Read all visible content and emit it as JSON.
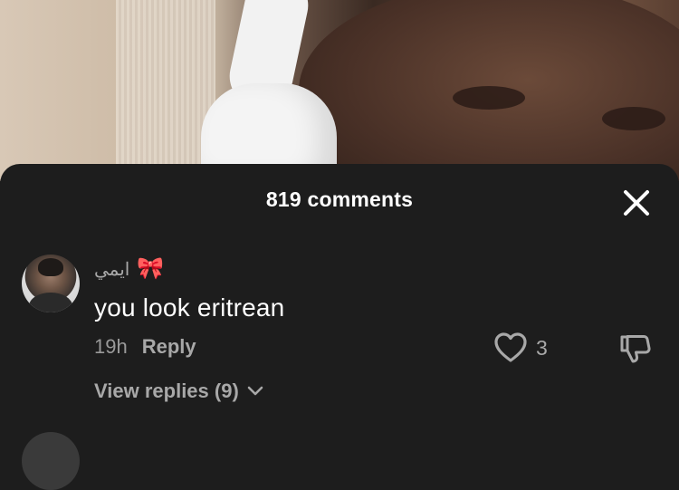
{
  "sheet": {
    "title": "819 comments"
  },
  "comment": {
    "username": "ايمي",
    "username_emoji": "🎀",
    "text": "you look eritrean",
    "time": "19h",
    "reply_label": "Reply",
    "like_count": "3",
    "view_replies_label": "View replies (9)"
  },
  "icons": {
    "close": "close-icon",
    "like": "heart-outline-icon",
    "dislike": "thumbs-down-icon",
    "chevron": "chevron-down-icon"
  },
  "colors": {
    "sheet_bg": "#1d1d1d",
    "primary_text": "#ffffff",
    "secondary_text": "#a8a8a8"
  }
}
